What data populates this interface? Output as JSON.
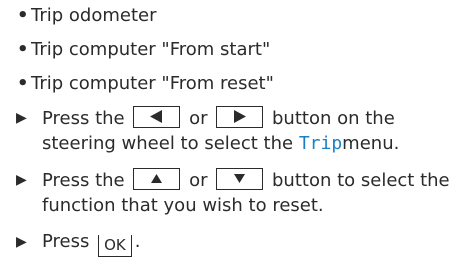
{
  "bullets": [
    "Trip odometer",
    "Trip computer \"From start\"",
    "Trip computer \"From reset\""
  ],
  "steps": {
    "one": {
      "before": "Press the",
      "or": "or",
      "after": "button on the",
      "line2_before": "steering wheel to select the",
      "menu_word": "Trip",
      "line2_after": "menu."
    },
    "two": {
      "before": "Press the",
      "or": "or",
      "after": "button to select the",
      "line2": "function that you wish to reset."
    },
    "three": {
      "before": "Press",
      "ok_label": "OK",
      "after": "."
    }
  },
  "icons": {
    "step_marker": "triangle-right-icon",
    "left_button": "arrow-left-icon",
    "right_button": "arrow-right-icon",
    "up_button": "arrow-up-icon",
    "down_button": "arrow-down-icon"
  },
  "colors": {
    "text": "#2b2b2b",
    "menu_word": "#1a7fc4"
  }
}
